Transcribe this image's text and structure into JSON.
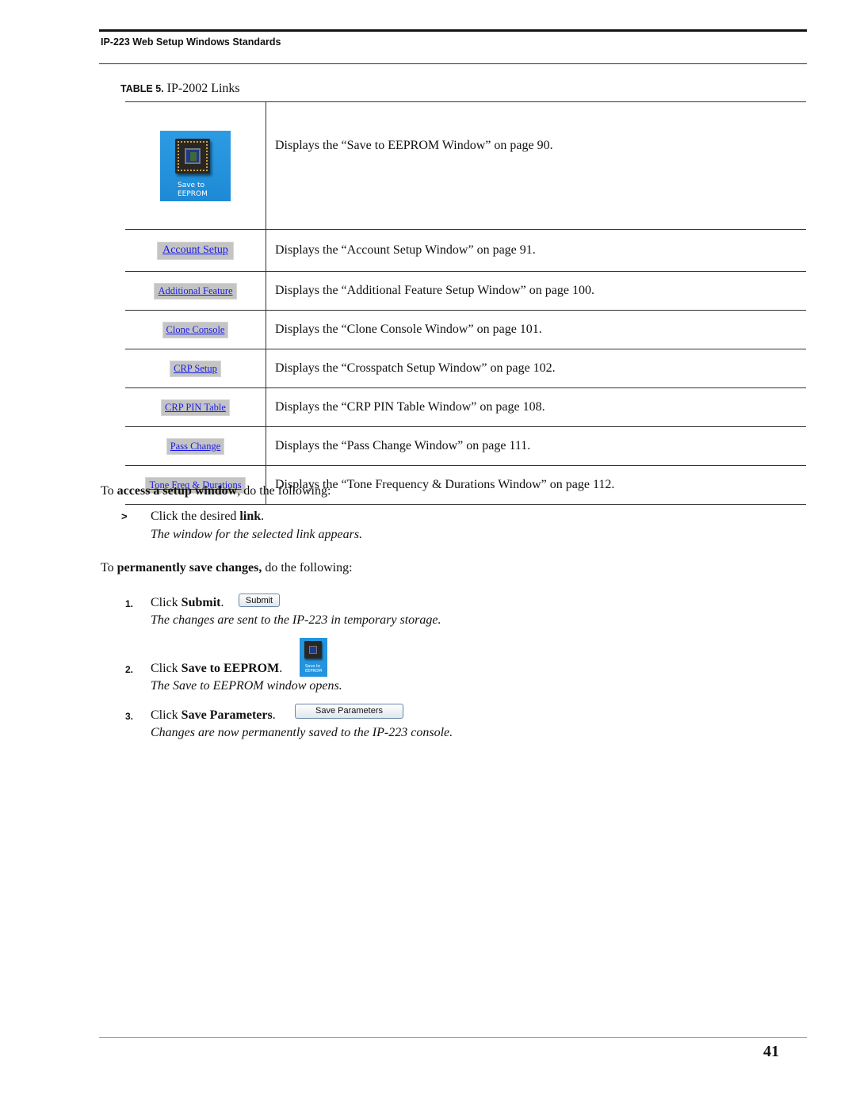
{
  "header": {
    "running_head": "IP-223 Web Setup Windows Standards"
  },
  "table": {
    "caption_label": "TABLE 5.",
    "caption_title": "IP-2002 Links",
    "rows": [
      {
        "link_label": "Save to EEPROM",
        "icon": "save-to-eeprom-chip-icon",
        "description": "Displays the “Save to EEPROM Window” on page 90."
      },
      {
        "link_label": "Account Setup",
        "description": "Displays the “Account Setup Window” on page 91."
      },
      {
        "link_label": "Additional Feature",
        "description": "Displays the “Additional Feature Setup Window” on page 100."
      },
      {
        "link_label": "Clone Console",
        "description": "Displays the “Clone Console Window” on page 101."
      },
      {
        "link_label": "CRP Setup",
        "description": "Displays the “Crosspatch Setup Window” on page 102."
      },
      {
        "link_label": "CRP PIN Table",
        "description": "Displays the “CRP PIN Table Window” on page 108."
      },
      {
        "link_label": "Pass Change",
        "description": "Displays the “Pass Change Window” on page 111."
      },
      {
        "link_label": "Tone Freq & Durations",
        "description": "Displays the “Tone Frequency & Durations Window” on page 112."
      }
    ]
  },
  "access": {
    "intro_prefix": "To ",
    "intro_bold": "access a setup window",
    "intro_suffix": ", do the following:",
    "bullet": ">",
    "step_prefix": "Click the desired ",
    "step_bold": "link",
    "step_suffix": ".",
    "result": "The window for the selected link appears."
  },
  "save": {
    "intro_prefix": "To ",
    "intro_bold": "permanently save changes,",
    "intro_suffix": " do the following:",
    "steps": [
      {
        "num": "1.",
        "prefix": "Click ",
        "bold": "Submit",
        "suffix": ".",
        "button_label": "Submit",
        "result": "The changes are sent to the IP-223 in temporary storage."
      },
      {
        "num": "2.",
        "prefix": "Click ",
        "bold": "Save to EEPROM",
        "suffix": ".",
        "button_label": "Save to EEPROM",
        "result": "The Save to EEPROM window opens."
      },
      {
        "num": "3.",
        "prefix": "Click ",
        "bold": "Save Parameters",
        "suffix": ".",
        "button_label": "Save Parameters",
        "result": "Changes are now permanently saved to the IP-223 console."
      }
    ]
  },
  "footer": {
    "page_number": "41"
  },
  "colors": {
    "link": "#1a1aee",
    "link_button_bg": "#c4c4c4",
    "eeprom_tile": "#2494de"
  }
}
